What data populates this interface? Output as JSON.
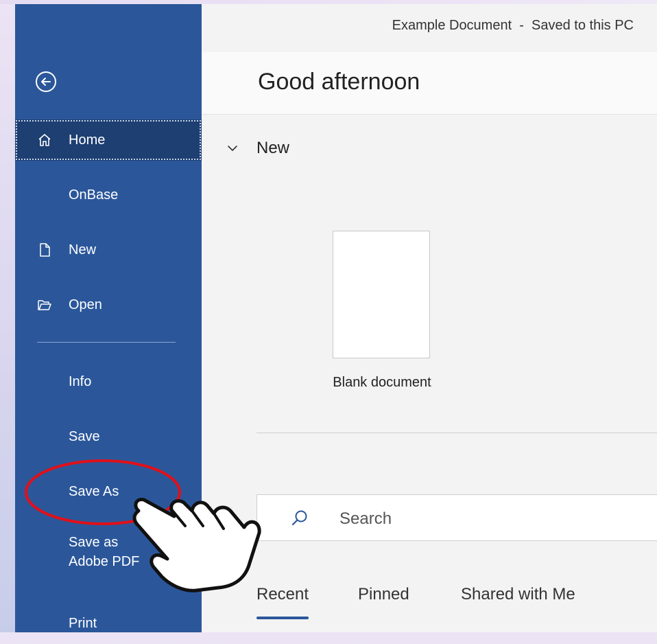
{
  "document": {
    "title": "Example Document  -  Saved to this PC"
  },
  "backstage": {
    "greeting": "Good afternoon",
    "new_section": {
      "heading": "New",
      "templates": [
        {
          "label": "Blank document"
        }
      ]
    },
    "search": {
      "placeholder": "Search",
      "value": ""
    },
    "tabs": [
      {
        "label": "Recent",
        "active": true
      },
      {
        "label": "Pinned",
        "active": false
      },
      {
        "label": "Shared with Me",
        "active": false
      }
    ]
  },
  "sidebar": {
    "items": [
      {
        "label": "Home",
        "icon": "home-icon",
        "active": true
      },
      {
        "label": "OnBase",
        "icon": "",
        "active": false
      },
      {
        "label": "New",
        "icon": "new-document-icon",
        "active": false
      },
      {
        "label": "Open",
        "icon": "open-folder-icon",
        "active": false
      },
      {
        "label": "Info"
      },
      {
        "label": "Save"
      },
      {
        "label": "Save As",
        "highlighted": true
      },
      {
        "label": "Save as Adobe PDF"
      },
      {
        "label": "Print"
      }
    ]
  },
  "colors": {
    "sidebar_bg": "#2b579a",
    "sidebar_active_bg": "#1d3f72",
    "main_bg": "#f3f3f3",
    "annotation": "#e0101a"
  }
}
